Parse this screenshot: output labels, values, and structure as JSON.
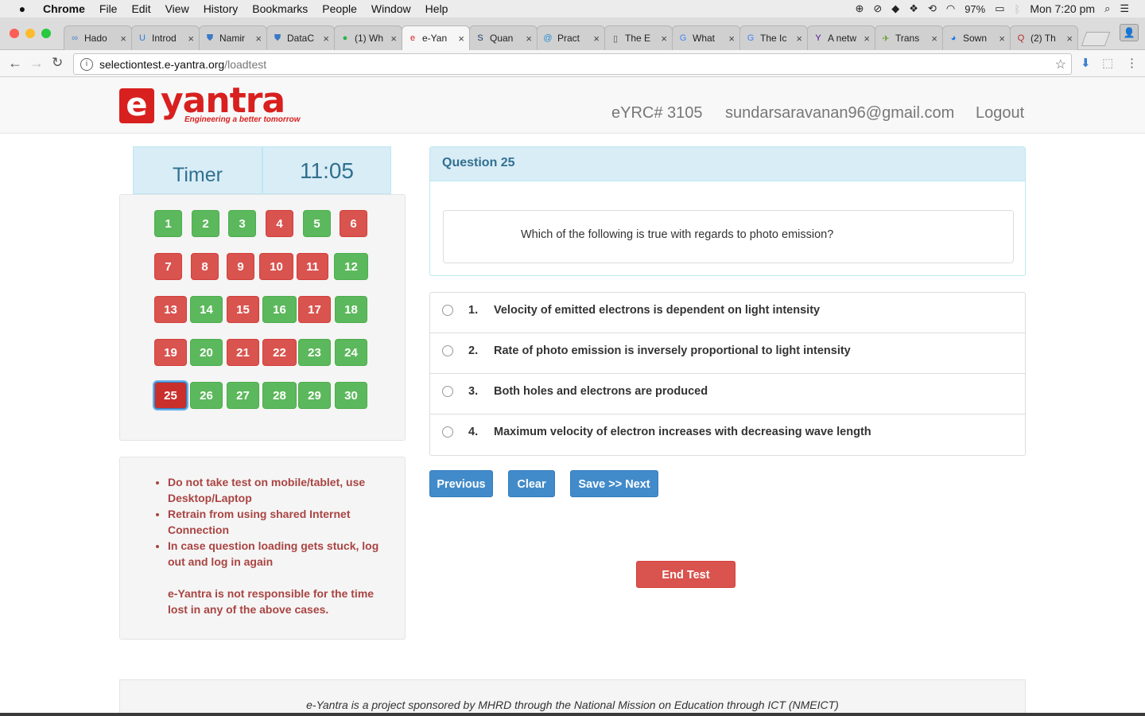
{
  "menubar": {
    "app": "Chrome",
    "items": [
      "File",
      "Edit",
      "View",
      "History",
      "Bookmarks",
      "People",
      "Window",
      "Help"
    ],
    "battery": "97%",
    "clock": "Mon 7:20 pm"
  },
  "tabs": [
    {
      "label": "Hado",
      "icon": "infinity-icon",
      "icon_char": "∞",
      "icon_color": "#4a7fd0"
    },
    {
      "label": "Introd",
      "icon": "udemy-icon",
      "icon_char": "U",
      "icon_color": "#2a7be4"
    },
    {
      "label": "Namir",
      "icon": "shield-icon",
      "icon_char": "⛊",
      "icon_color": "#3a78c8"
    },
    {
      "label": "DataC",
      "icon": "shield-icon",
      "icon_char": "⛊",
      "icon_color": "#3a78c8"
    },
    {
      "label": "(1) Wh",
      "icon": "whatsapp-icon",
      "icon_char": "●",
      "icon_color": "#2bb34a"
    },
    {
      "label": "e-Yan",
      "icon": "eyantra-icon",
      "icon_char": "e",
      "icon_color": "#d8201f"
    },
    {
      "label": "Quan",
      "icon": "s-logo-icon",
      "icon_char": "S",
      "icon_color": "#1a3d6d"
    },
    {
      "label": "Pract",
      "icon": "geeks-icon",
      "icon_char": "@",
      "icon_color": "#2a8dd6"
    },
    {
      "label": "The E",
      "icon": "document-icon",
      "icon_char": "▯",
      "icon_color": "#555555"
    },
    {
      "label": "What",
      "icon": "google-icon",
      "icon_char": "G",
      "icon_color": "#4285f4"
    },
    {
      "label": "The Ic",
      "icon": "google-icon",
      "icon_char": "G",
      "icon_color": "#4285f4"
    },
    {
      "label": "A netw",
      "icon": "yahoo-icon",
      "icon_char": "Y",
      "icon_color": "#4b0f8f"
    },
    {
      "label": "Trans",
      "icon": "bird-icon",
      "icon_char": "✈",
      "icon_color": "#6a9a2a"
    },
    {
      "label": "Sown",
      "icon": "messenger-icon",
      "icon_char": "◕",
      "icon_color": "#1877f2"
    },
    {
      "label": "(2) Th",
      "icon": "quora-icon",
      "icon_char": "Q",
      "icon_color": "#b92b27"
    }
  ],
  "active_tab_index": 5,
  "address": {
    "host": "selectiontest.e-yantra.org",
    "path": "/loadtest"
  },
  "header": {
    "logo_text": "yantra",
    "logo_mark": "e",
    "logo_tagline": "Engineering a better tomorrow",
    "reg_id": "eYRC# 3105",
    "email": "sundarsaravanan96@gmail.com",
    "logout": "Logout"
  },
  "timer": {
    "label": "Timer",
    "value": "11:05"
  },
  "palette": {
    "questions": [
      {
        "n": "1",
        "status": "answered"
      },
      {
        "n": "2",
        "status": "answered"
      },
      {
        "n": "3",
        "status": "answered"
      },
      {
        "n": "4",
        "status": "unanswered"
      },
      {
        "n": "5",
        "status": "answered"
      },
      {
        "n": "6",
        "status": "unanswered"
      },
      {
        "n": "7",
        "status": "unanswered"
      },
      {
        "n": "8",
        "status": "unanswered"
      },
      {
        "n": "9",
        "status": "unanswered"
      },
      {
        "n": "10",
        "status": "unanswered"
      },
      {
        "n": "11",
        "status": "unanswered"
      },
      {
        "n": "12",
        "status": "answered"
      },
      {
        "n": "13",
        "status": "unanswered"
      },
      {
        "n": "14",
        "status": "answered"
      },
      {
        "n": "15",
        "status": "unanswered"
      },
      {
        "n": "16",
        "status": "answered"
      },
      {
        "n": "17",
        "status": "unanswered"
      },
      {
        "n": "18",
        "status": "answered"
      },
      {
        "n": "19",
        "status": "unanswered"
      },
      {
        "n": "20",
        "status": "answered"
      },
      {
        "n": "21",
        "status": "unanswered"
      },
      {
        "n": "22",
        "status": "unanswered"
      },
      {
        "n": "23",
        "status": "answered"
      },
      {
        "n": "24",
        "status": "answered"
      },
      {
        "n": "25",
        "status": "current"
      },
      {
        "n": "26",
        "status": "answered"
      },
      {
        "n": "27",
        "status": "answered"
      },
      {
        "n": "28",
        "status": "answered"
      },
      {
        "n": "29",
        "status": "answered"
      },
      {
        "n": "30",
        "status": "answered"
      }
    ]
  },
  "notes": {
    "items": [
      "Do not take test on mobile/tablet, use Desktop/Laptop",
      "Retrain from using shared Internet Connection",
      "In case question loading gets stuck, log out and log in again"
    ],
    "disclaimer": "e-Yantra is not responsible for the time lost in any of the above cases."
  },
  "question": {
    "title": "Question 25",
    "text": "Which of the following is true with regards to photo emission?",
    "options": [
      {
        "num": "1.",
        "text": "Velocity of emitted electrons is dependent on light intensity"
      },
      {
        "num": "2.",
        "text": "Rate of photo emission is inversely proportional to light intensity"
      },
      {
        "num": "3.",
        "text": "Both holes and electrons are produced"
      },
      {
        "num": "4.",
        "text": "Maximum velocity of electron increases with decreasing wave length"
      }
    ]
  },
  "buttons": {
    "previous": "Previous",
    "clear": "Clear",
    "save_next": "Save >> Next",
    "end_test": "End Test"
  },
  "footer": {
    "text": "e-Yantra is a project sponsored by MHRD through the National Mission on Education through ICT (NMEICT)"
  },
  "colors": {
    "answered": "#5cb85c",
    "unanswered": "#d9534f",
    "current": "#c9302c",
    "brand": "#d8201f",
    "primary": "#428bca"
  }
}
